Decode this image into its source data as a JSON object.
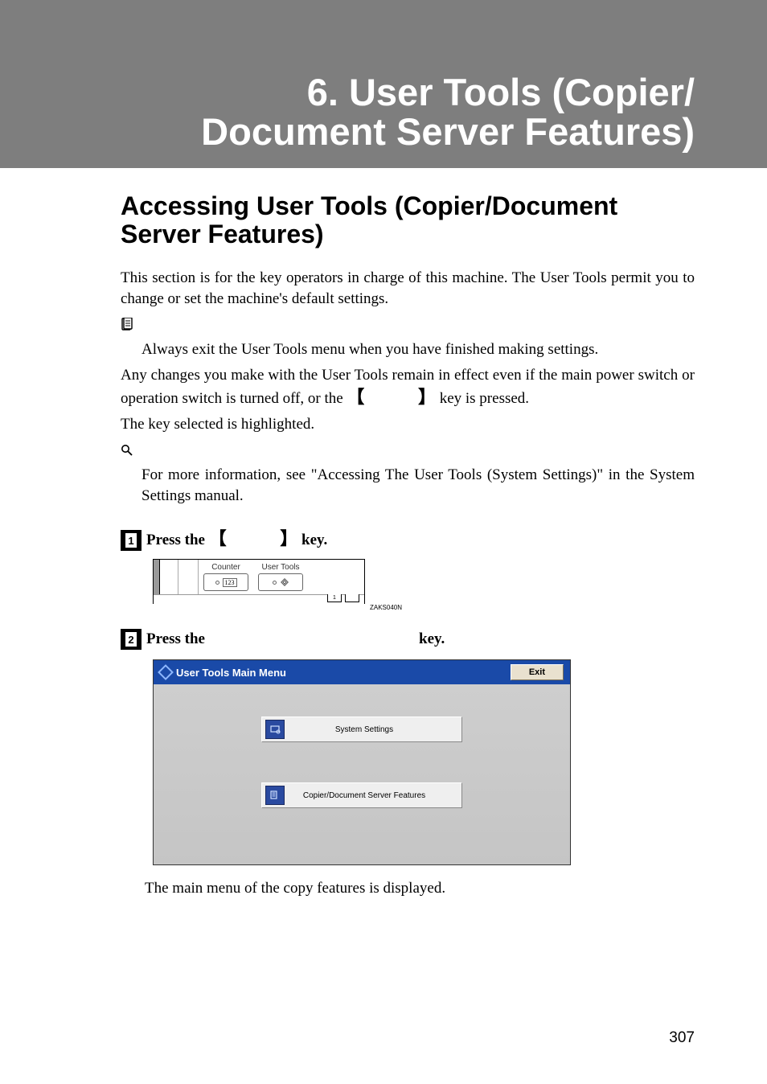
{
  "chapter_title": "6. User Tools (Copier/\nDocument Server Features)",
  "section_title": "Accessing User Tools (Copier/Document Server Features)",
  "para1": "This section is for the key operators in charge of this machine. The User Tools permit you to change or set the machine's default settings.",
  "note_line": "Always exit the User Tools menu when you have finished making settings.",
  "para2a": "Any changes you make with the User Tools remain in effect even if the main power switch or operation switch is turned off, or the ",
  "bracket_open": "【",
  "bracket_close": "】",
  "para2b": " key is pressed.",
  "para3": "The key selected is highlighted.",
  "ref_line": "For more information, see \"Accessing The User Tools (System Settings)\" in the System Settings manual.",
  "steps": {
    "s1": {
      "num": "1",
      "prefix": "Press the ",
      "suffix": " key."
    },
    "s2": {
      "num": "2",
      "prefix": "Press the ",
      "suffix": " key."
    }
  },
  "fig1": {
    "counter_label": "Counter",
    "usertools_label": "User Tools",
    "counter_glyph": "123",
    "tab1": "1",
    "code": "ZAKS040N"
  },
  "fig2": {
    "titlebar": "User Tools Main Menu",
    "exit": "Exit",
    "btn1": "System Settings",
    "btn2": "Copier/Document Server Features"
  },
  "post_figure": "The main menu of the copy features is displayed.",
  "page_number": "307"
}
